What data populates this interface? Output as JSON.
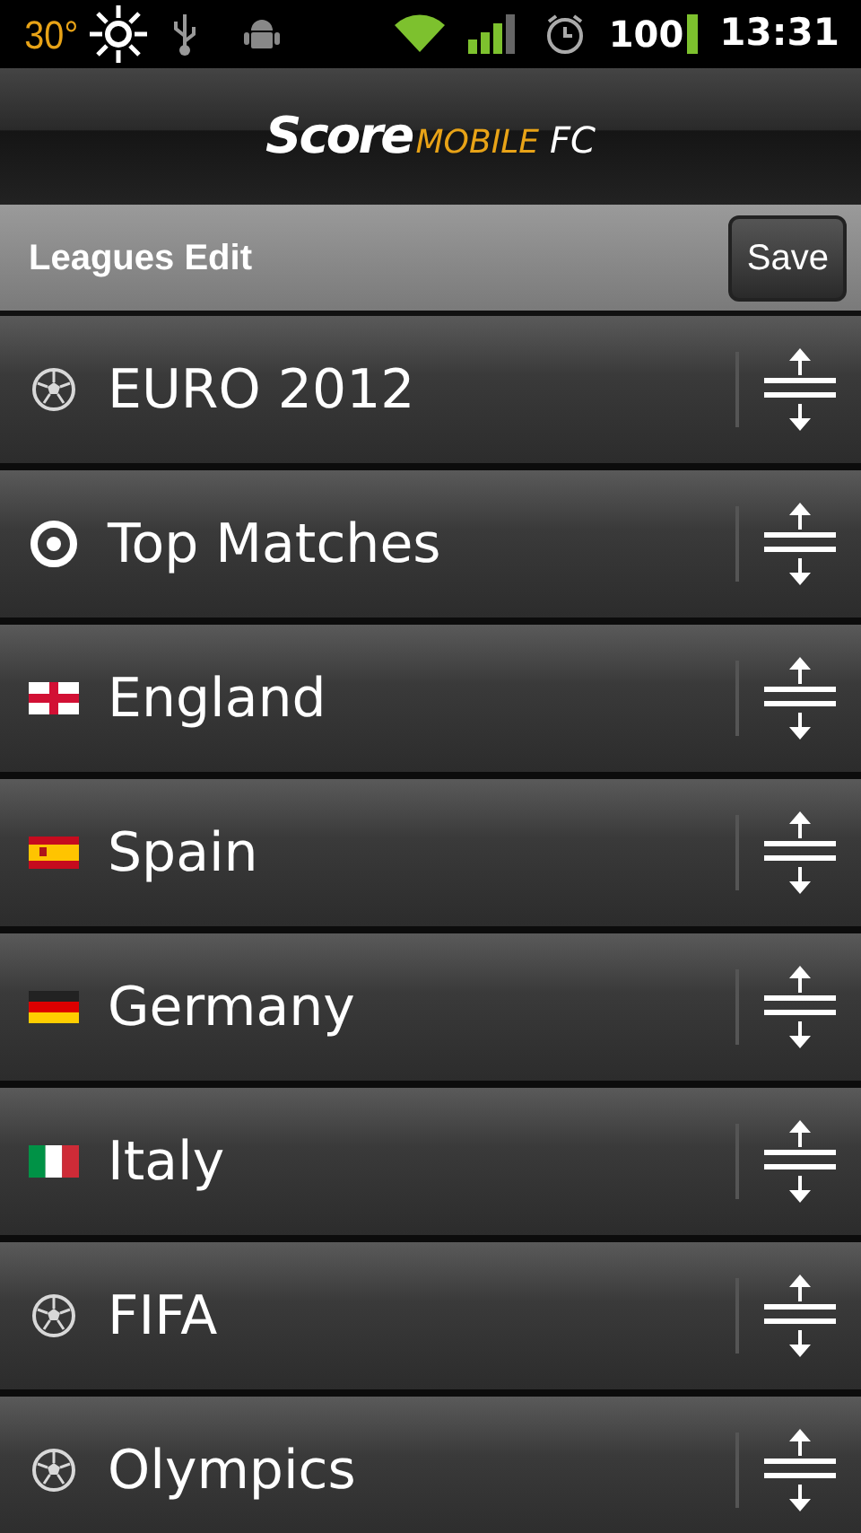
{
  "status_bar": {
    "temperature": "30°",
    "battery": "100",
    "time": "13:31"
  },
  "header": {
    "logo_main": "Score",
    "logo_sub": "MOBILE",
    "logo_suffix": "FC"
  },
  "toolbar": {
    "title": "Leagues Edit",
    "save_button": "Save"
  },
  "leagues": [
    {
      "name": "EURO 2012",
      "kind": "ball"
    },
    {
      "name": "Top Matches",
      "kind": "target"
    },
    {
      "name": "England",
      "kind": "england"
    },
    {
      "name": "Spain",
      "kind": "spain"
    },
    {
      "name": "Germany",
      "kind": "germany"
    },
    {
      "name": "Italy",
      "kind": "italy"
    },
    {
      "name": "FIFA",
      "kind": "ball"
    },
    {
      "name": "Olympics",
      "kind": "ball"
    }
  ]
}
